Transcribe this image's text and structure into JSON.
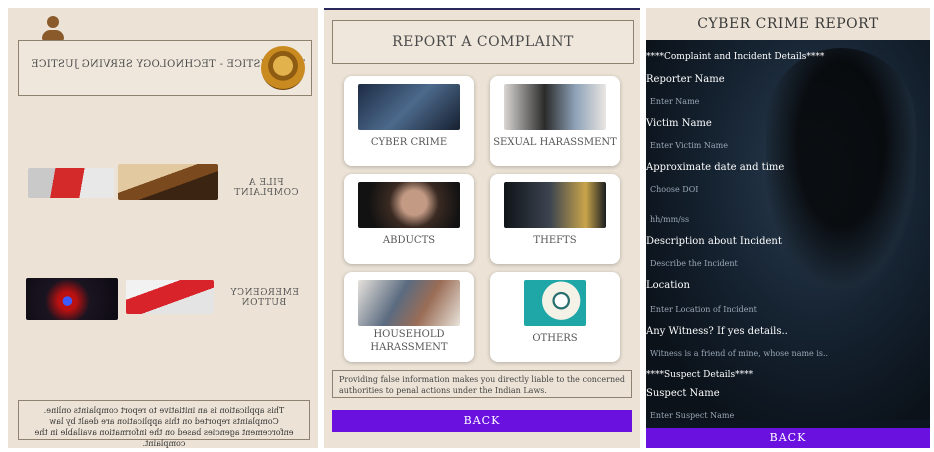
{
  "home": {
    "header_text": "TECHJUSTICE - TECHNOLOGY SERVING JUSTICE",
    "file_complaint": "FILE A COMPLAINT",
    "emergency_line1": "EMERGENCY",
    "emergency_line2": "BUTTON",
    "footer": "This application is an initiative to report complaints online. Complaints reported on this application are dealt by law enforcement agencies based on the information available in the complaint.",
    "icons": [
      "user-icon",
      "emblem-icon"
    ]
  },
  "report": {
    "title": "REPORT A COMPLAINT",
    "categories": [
      {
        "label": "CYBER CRIME"
      },
      {
        "label": "SEXUAL HARASSMENT"
      },
      {
        "label": "ABDUCTS"
      },
      {
        "label": "THEFTS"
      },
      {
        "label_line1": "HOUSEHOLD",
        "label_line2": "HARASSMENT"
      },
      {
        "label": "OTHERS"
      }
    ],
    "warning": "Providing false information makes you directly liable to the concerned authorities to penal actions under the Indian Laws.",
    "back_label": "BACK"
  },
  "form": {
    "title": "CYBER CRIME REPORT",
    "section1": "****Complaint and Incident Details****",
    "reporter_label": "Reporter Name",
    "reporter_placeholder": "Enter Name",
    "victim_label": "Victim Name",
    "victim_placeholder": "Enter Victim Name",
    "datetime_label": "Approximate date and time",
    "date_placeholder": "Choose DOI",
    "time_placeholder": "hh/mm/ss",
    "description_label": "Description about Incident",
    "description_placeholder": "Describe the Incident",
    "location_label": "Location",
    "location_placeholder": "Enter Location of Incident",
    "witness_label": "Any Witness? If yes details..",
    "witness_placeholder": "Witness is a friend of mine, whose name is..",
    "section2": "****Suspect Details****",
    "suspect_label": "Suspect Name",
    "suspect_placeholder": "Enter Suspect Name",
    "back_label": "BACK"
  },
  "colors": {
    "beige": "#ece3d6",
    "accent_purple": "#6a11e0",
    "dark_bg": "#0d1620"
  }
}
